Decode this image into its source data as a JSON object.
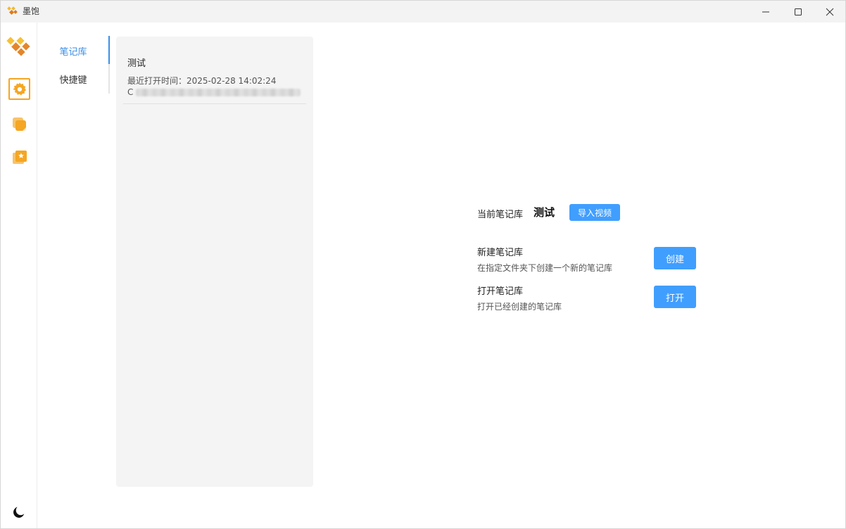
{
  "window": {
    "title": "墨饱",
    "controls": [
      "minimize-icon",
      "maximize-icon",
      "close-icon"
    ]
  },
  "sidebar": {
    "items": [
      {
        "icon": "settings-gear-icon",
        "active": true
      },
      {
        "icon": "notes-stack-icon",
        "active": false
      },
      {
        "icon": "starred-collection-icon",
        "active": false
      }
    ],
    "bottom_icon": "dark-mode-moon-icon",
    "accent": "#f5a623"
  },
  "subnav": {
    "items": [
      {
        "label": "笔记库",
        "active": true
      },
      {
        "label": "快捷键",
        "active": false
      }
    ],
    "active_color": "#3b8fe8"
  },
  "libraries": [
    {
      "name": "测试",
      "last_opened": "最近打开时间：2025-02-28 14:02:24",
      "path_prefix": "C"
    }
  ],
  "main": {
    "current_label": "当前笔记库",
    "current_name": "测试",
    "import_button": "导入视频",
    "new_library": {
      "title": "新建笔记库",
      "description": "在指定文件夹下创建一个新的笔记库",
      "button": "创建"
    },
    "open_library": {
      "title": "打开笔记库",
      "description": "打开已经创建的笔记库",
      "button": "打开"
    },
    "button_color": "#409eff"
  }
}
